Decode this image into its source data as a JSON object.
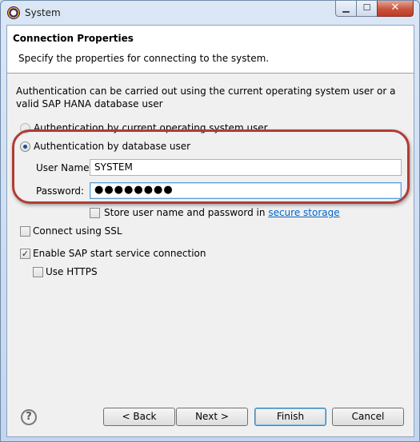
{
  "window": {
    "title": "System",
    "controls": {
      "minimize": "▁",
      "maximize": "☐",
      "close": "✕"
    }
  },
  "header": {
    "title": "Connection Properties",
    "description": "Specify the properties for connecting to the system."
  },
  "auth": {
    "description": "Authentication can be carried out using the current operating system user or a valid SAP HANA database user",
    "option_os_user": "Authentication by current operating system user",
    "option_os_user_selected": false,
    "option_db_user": "Authentication by database user",
    "option_db_user_selected": true,
    "username_label": "User Name:",
    "username_value": "SYSTEM",
    "password_label": "Password:",
    "password_masked": "●●●●●●●●",
    "store_label": "Store user name and password in",
    "store_link": "secure storage",
    "store_checked": false
  },
  "options": {
    "ssl_label": "Connect using SSL",
    "ssl_checked": false,
    "sap_start_label": "Enable SAP start service connection",
    "sap_start_checked": true,
    "https_label": "Use HTTPS",
    "https_checked": false
  },
  "footer": {
    "help": "?",
    "back": "< Back",
    "next": "Next >",
    "finish": "Finish",
    "cancel": "Cancel"
  },
  "colors": {
    "highlight_ring": "#b13c36",
    "link": "#0066cc"
  }
}
